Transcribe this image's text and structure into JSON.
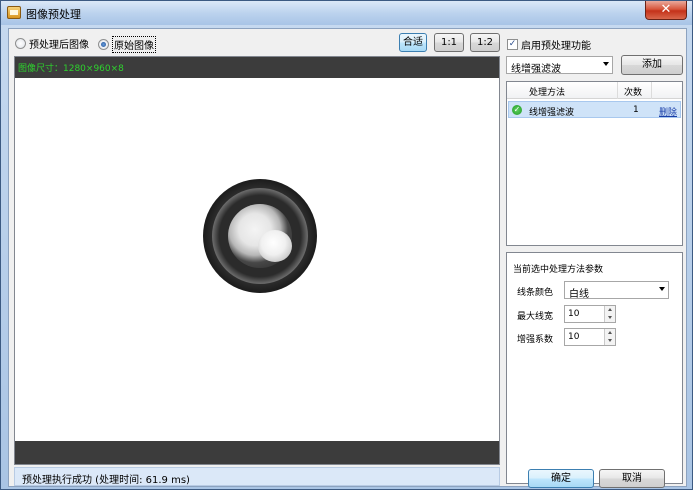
{
  "window": {
    "title": "图像预处理",
    "close_glyph": "✕"
  },
  "view_mode": {
    "options": [
      {
        "label": "预处理后图像",
        "selected": false
      },
      {
        "label": "原始图像",
        "selected": true
      }
    ]
  },
  "zoom_buttons": {
    "fit": "合适",
    "one_to_one": "1:1",
    "one_to_two": "1:2",
    "active": "fit"
  },
  "enable_preprocess": {
    "label": "启用预处理功能",
    "checked": true,
    "check_glyph": "✓"
  },
  "preview": {
    "image_size_text": "图像尺寸：1280×960×8"
  },
  "status": {
    "message": "预处理执行成功 (处理时间: 61.9 ms)"
  },
  "method_select": {
    "value": "线增强滤波"
  },
  "add_button": "添加",
  "method_table": {
    "columns": [
      "处理方法",
      "次数"
    ],
    "rows": [
      {
        "name": "线增强滤波",
        "count": "1",
        "action": "删除",
        "status_icon": "check-circle-icon"
      }
    ]
  },
  "params": {
    "title": "当前选中处理方法参数",
    "line_color": {
      "label": "线条颜色",
      "value": "白线"
    },
    "max_line_width": {
      "label": "最大线宽",
      "value": "10"
    },
    "enhance_factor": {
      "label": "增强系数",
      "value": "10"
    }
  },
  "footer": {
    "ok": "确定",
    "cancel": "取消"
  },
  "colors": {
    "accent_active": "#bee6fd",
    "size_text": "#2ed12e",
    "status_bg": "#dbe8f8",
    "selected_row": "#cfe3f8"
  }
}
